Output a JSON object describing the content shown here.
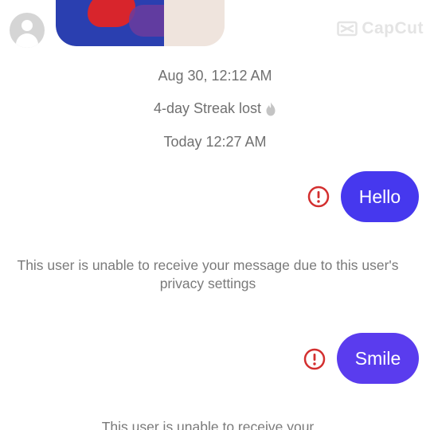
{
  "header": {
    "avatar_icon": "default-user-avatar-icon",
    "watermark": "CapCut"
  },
  "colors": {
    "sent_bubble": "#4638ee",
    "error_red": "#d32f2f",
    "meta_text": "#707070"
  },
  "conversation": {
    "timestamp_1": "Aug 30, 12:12 AM",
    "streak_text": "4-day Streak lost",
    "streak_icon": "flame-icon",
    "timestamp_2": "Today 12:27 AM",
    "messages": [
      {
        "text": "Hello",
        "status_icon": "error-icon",
        "note": "This user is unable to receive your message due to this user's privacy settings"
      },
      {
        "text": "Smile",
        "status_icon": "error-icon",
        "note": "This user is unable to receive your"
      }
    ]
  }
}
